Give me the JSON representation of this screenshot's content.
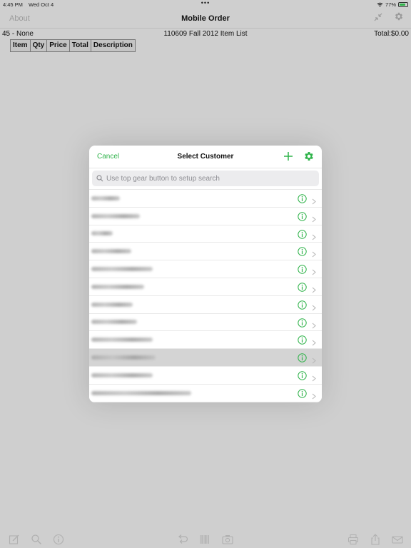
{
  "status_bar": {
    "time": "4:45 PM",
    "date": "Wed Oct 4",
    "battery_percent": "77%",
    "battery_level": 0.77,
    "icons": [
      "wifi-icon",
      "battery-icon"
    ]
  },
  "nav": {
    "about_label": "About",
    "title": "Mobile Order",
    "icons": [
      "collapse-icon",
      "gear-icon"
    ]
  },
  "info": {
    "customer": "45 - None",
    "item_list": "110609 Fall 2012 Item List",
    "total": "Total:$0.00"
  },
  "table_header": {
    "columns": [
      "Item",
      "Qty",
      "Price",
      "Total",
      "Description"
    ]
  },
  "modal": {
    "cancel_label": "Cancel",
    "title": "Select Customer",
    "icons": [
      "plus-icon",
      "gear-icon"
    ],
    "search_placeholder": "Use top gear button to setup search",
    "rows_count_visible": 12,
    "selected_row_index": 9
  },
  "colors": {
    "accent": "#2fb34a",
    "background": "#cfcfcf",
    "selected_row": "#d4d4d4"
  },
  "toolbar": {
    "icons": [
      "compose-icon",
      "search-icon",
      "info-icon",
      "undo-icon",
      "barcode-icon",
      "camera-icon",
      "print-icon",
      "share-icon",
      "mail-icon"
    ]
  }
}
